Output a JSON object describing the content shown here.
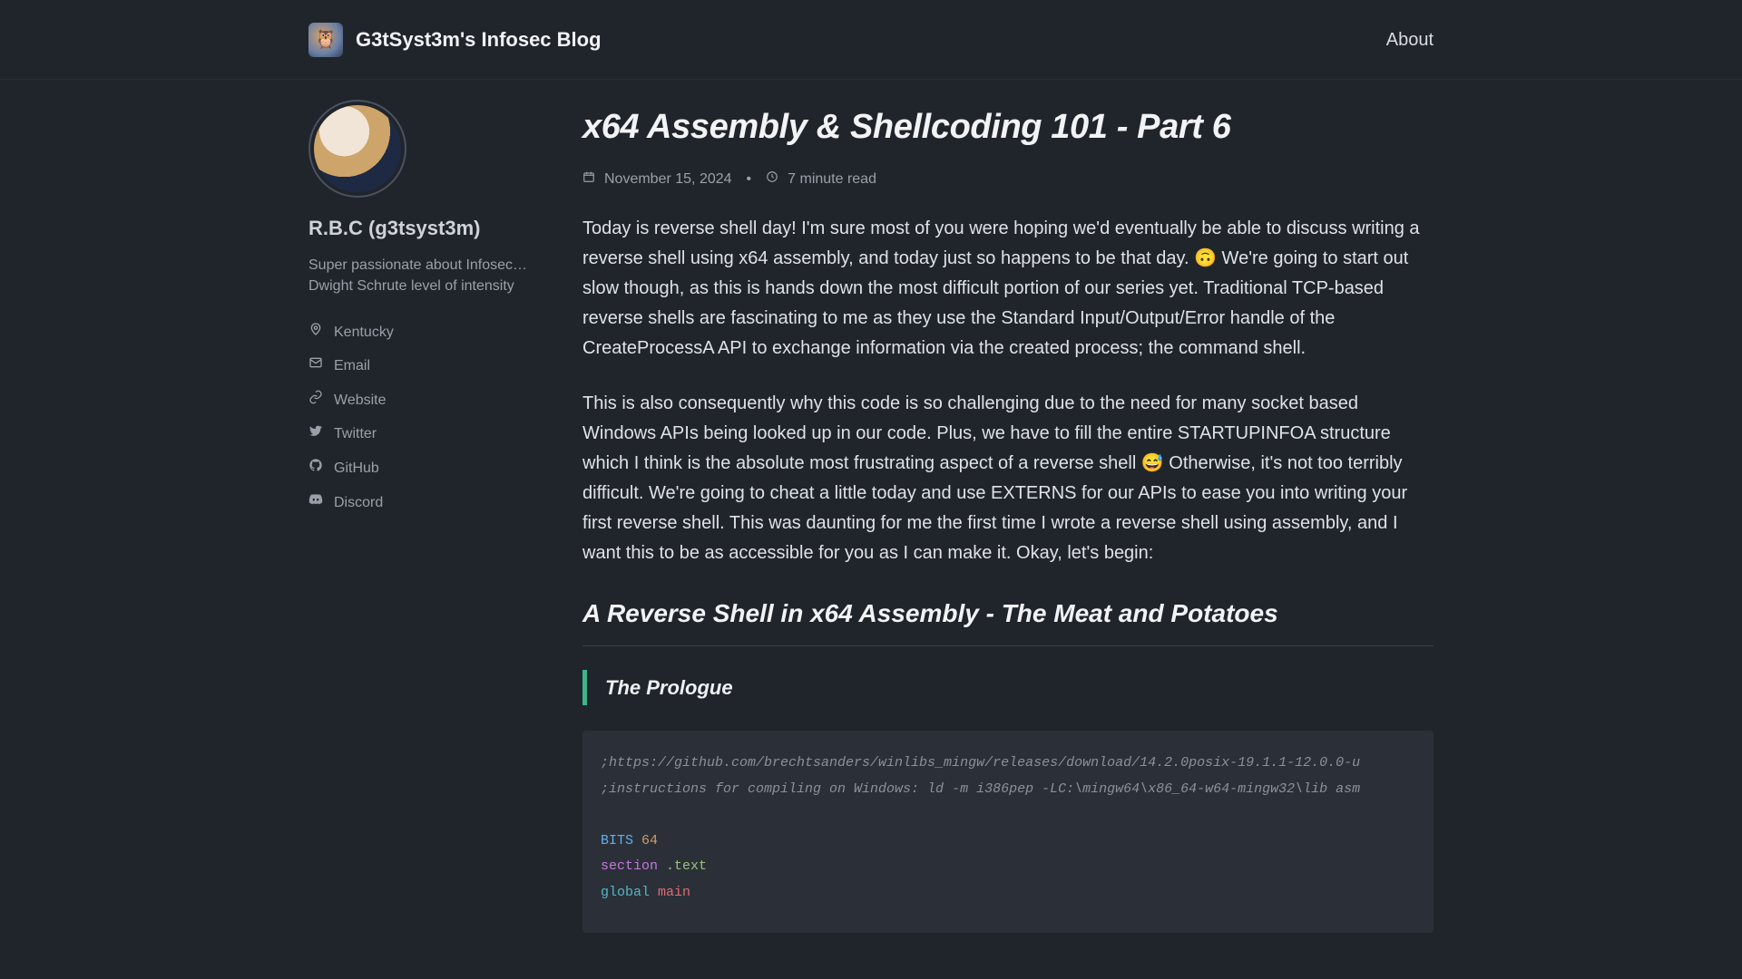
{
  "header": {
    "brand_title": "G3tSyst3m's Infosec Blog",
    "about": "About"
  },
  "sidebar": {
    "author_name": "R.B.C (g3tsyst3m)",
    "bio_line1": "Super passionate about Infosec…",
    "bio_line2": "Dwight Schrute level of intensity",
    "items": {
      "location": "Kentucky",
      "email": "Email",
      "website": "Website",
      "twitter": "Twitter",
      "github": "GitHub",
      "discord": "Discord"
    }
  },
  "article": {
    "title": "x64 Assembly & Shellcoding 101 - Part 6",
    "date": "November 15, 2024",
    "dot": "•",
    "readtime": "7 minute read",
    "para1": "Today is reverse shell day! I'm sure most of you were hoping we'd eventually be able to discuss writing a reverse shell using x64 assembly, and today just so happens to be that day. 🙃 We're going to start out slow though, as this is hands down the most difficult portion of our series yet. Traditional TCP-based reverse shells are fascinating to me as they use the Standard Input/Output/Error handle of the CreateProcessA API to exchange information via the created process; the command shell.",
    "para2": "This is also consequently why this code is so challenging due to the need for many socket based Windows APIs being looked up in our code. Plus, we have to fill the entire STARTUPINFOA structure which I think is the absolute most frustrating aspect of a reverse shell 😅 Otherwise, it's not too terribly difficult. We're going to cheat a little today and use EXTERNS for our APIs to ease you into writing your first reverse shell. This was daunting for me the first time I wrote a reverse shell using assembly, and I want this to be as accessible for you as I can make it. Okay, let's begin:",
    "h2": "A Reverse Shell in x64 Assembly - The Meat and Potatoes",
    "h3": "The Prologue",
    "code": {
      "c1": ";https://github.com/brechtsanders/winlibs_mingw/releases/download/14.2.0posix-19.1.1-12.0.0-u",
      "c2": ";instructions for compiling on Windows: ld -m i386pep -LC:\\mingw64\\x86_64-w64-mingw32\\lib asm",
      "bits_kw": "BITS",
      "bits_val": "64",
      "section_kw": "section",
      "section_val": ".text",
      "global_kw": "global",
      "global_val": "main"
    }
  }
}
